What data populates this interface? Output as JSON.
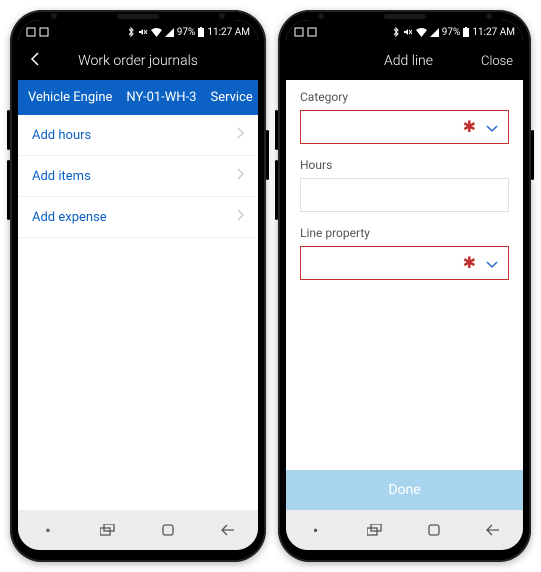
{
  "status": {
    "time": "11:27 AM",
    "battery": "97%"
  },
  "left": {
    "header_title": "Work order journals",
    "context": {
      "asset": "Vehicle Engine",
      "work_order": "NY-01-WH-3",
      "type": "Service"
    },
    "menu": {
      "add_hours": "Add hours",
      "add_items": "Add items",
      "add_expense": "Add expense"
    }
  },
  "right": {
    "header_title": "Add line",
    "close_label": "Close",
    "fields": {
      "category_label": "Category",
      "hours_label": "Hours",
      "line_property_label": "Line property"
    },
    "done_label": "Done"
  }
}
